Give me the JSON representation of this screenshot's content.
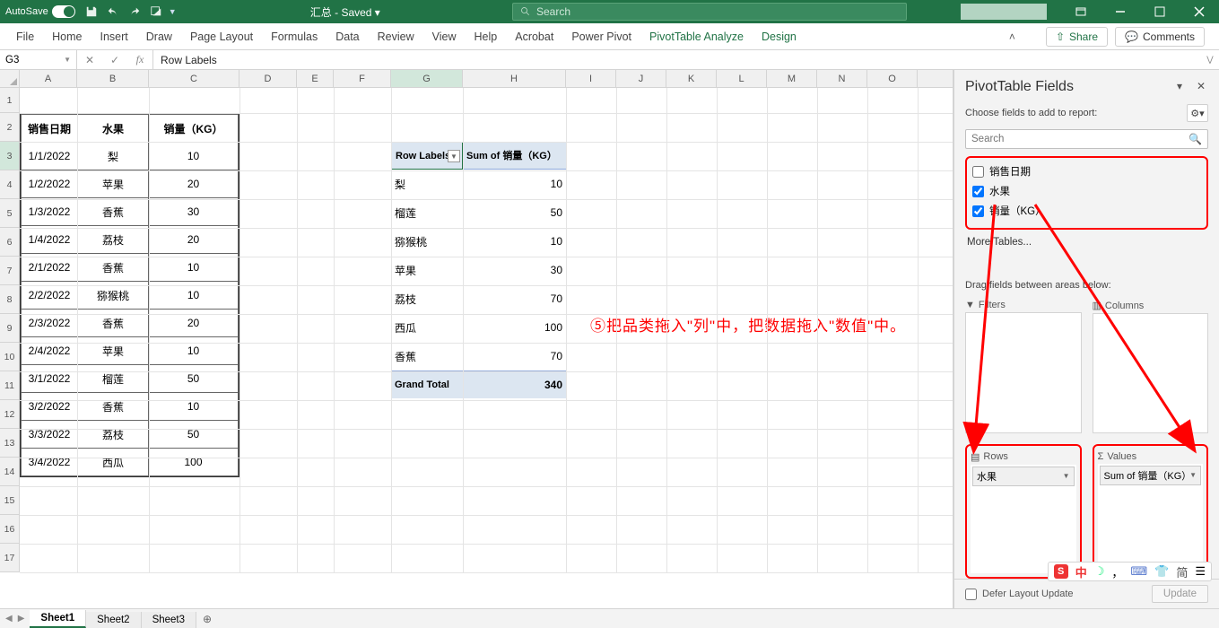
{
  "titlebar": {
    "autosave_label": "AutoSave",
    "autosave_on": "On",
    "doc_name": "汇总 - Saved ▾",
    "search_placeholder": "Search"
  },
  "ribbon": {
    "tabs": [
      "File",
      "Home",
      "Insert",
      "Draw",
      "Page Layout",
      "Formulas",
      "Data",
      "Review",
      "View",
      "Help",
      "Acrobat",
      "Power Pivot",
      "PivotTable Analyze",
      "Design"
    ],
    "share": "Share",
    "comments": "Comments"
  },
  "fxbar": {
    "name_box": "G3",
    "formula": "Row Labels"
  },
  "columns": [
    "A",
    "B",
    "C",
    "D",
    "E",
    "F",
    "G",
    "H",
    "I",
    "J",
    "K",
    "L",
    "M",
    "N",
    "O"
  ],
  "source_table": {
    "headers": [
      "销售日期",
      "水果",
      "销量（KG）"
    ],
    "rows": [
      [
        "1/1/2022",
        "梨",
        "10"
      ],
      [
        "1/2/2022",
        "苹果",
        "20"
      ],
      [
        "1/3/2022",
        "香蕉",
        "30"
      ],
      [
        "1/4/2022",
        "荔枝",
        "20"
      ],
      [
        "2/1/2022",
        "香蕉",
        "10"
      ],
      [
        "2/2/2022",
        "猕猴桃",
        "10"
      ],
      [
        "2/3/2022",
        "香蕉",
        "20"
      ],
      [
        "2/4/2022",
        "苹果",
        "10"
      ],
      [
        "3/1/2022",
        "榴莲",
        "50"
      ],
      [
        "3/2/2022",
        "香蕉",
        "10"
      ],
      [
        "3/3/2022",
        "荔枝",
        "50"
      ],
      [
        "3/4/2022",
        "西瓜",
        "100"
      ]
    ]
  },
  "pivot": {
    "row_label_header": "Row Labels",
    "value_header": "Sum of 销量（KG）",
    "rows": [
      [
        "梨",
        "10"
      ],
      [
        "榴莲",
        "50"
      ],
      [
        "猕猴桃",
        "10"
      ],
      [
        "苹果",
        "30"
      ],
      [
        "荔枝",
        "70"
      ],
      [
        "西瓜",
        "100"
      ],
      [
        "香蕉",
        "70"
      ]
    ],
    "grand_total_label": "Grand Total",
    "grand_total_value": "340"
  },
  "annotation": "⑤把品类拖入\"列\"中，把数据拖入\"数值\"中。",
  "pane": {
    "title": "PivotTable Fields",
    "subtitle": "Choose fields to add to report:",
    "search_placeholder": "Search",
    "fields": [
      {
        "label": "销售日期",
        "checked": false
      },
      {
        "label": "水果",
        "checked": true
      },
      {
        "label": "销量（KG）",
        "checked": true
      }
    ],
    "more_tables": "More Tables...",
    "drag_label": "Drag fields between areas below:",
    "areas": {
      "filters": "Filters",
      "columns": "Columns",
      "rows": "Rows",
      "values": "Values"
    },
    "rows_item": "水果",
    "values_item": "Sum of 销量（KG）",
    "defer": "Defer Layout Update",
    "update": "Update"
  },
  "sheets": [
    "Sheet1",
    "Sheet2",
    "Sheet3"
  ],
  "ime": {
    "zhong": "中",
    "jian": "简"
  }
}
